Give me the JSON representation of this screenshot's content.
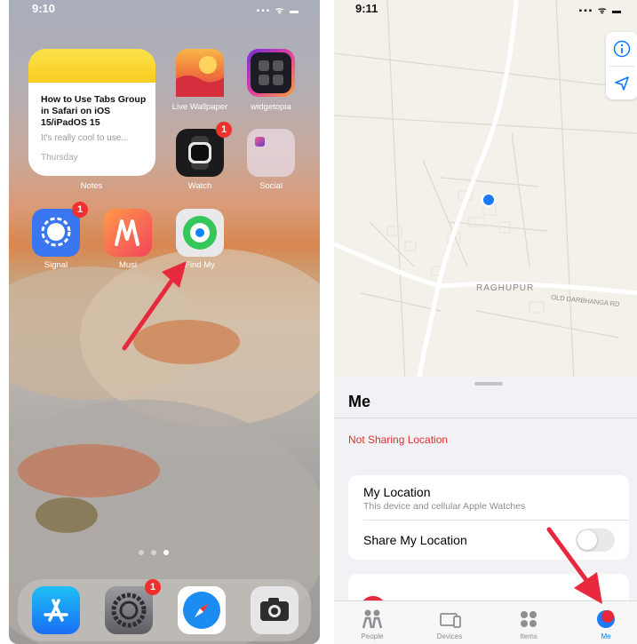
{
  "home": {
    "status_time": "9:10",
    "notes_widget": {
      "title": "How to Use Tabs Group in Safari on iOS 15/iPadOS 15",
      "preview": "It's really cool to use...",
      "day": "Thursday",
      "label": "Notes"
    },
    "apps": [
      {
        "label": "Live Wallpaper",
        "icon": "live-wallpaper-icon"
      },
      {
        "label": "widgetopia",
        "icon": "widgetopia-icon"
      },
      {
        "label": "Watch",
        "icon": "watch-icon",
        "badge": "1"
      },
      {
        "label": "Social",
        "icon": "folder-icon"
      },
      {
        "label": "Signal",
        "icon": "signal-icon",
        "badge": "1"
      },
      {
        "label": "Musi",
        "icon": "music-icon"
      },
      {
        "label": "Find My",
        "icon": "find-my-icon"
      }
    ],
    "dock": [
      {
        "icon": "app-store-icon"
      },
      {
        "icon": "settings-icon",
        "badge": "1"
      },
      {
        "icon": "safari-icon"
      },
      {
        "icon": "camera-icon"
      }
    ],
    "page_dots": 3,
    "active_page": 3
  },
  "findmy": {
    "status_time": "9:11",
    "map_labels": {
      "town": "RAGHUPUR",
      "road": "OLD DARBHANGA RD"
    },
    "sheet_title": "Me",
    "not_sharing": "Not Sharing Location",
    "my_location_title": "My Location",
    "my_location_sub": "This device and cellular Apple Watches",
    "share_label": "Share My Location",
    "share_enabled": false,
    "tabs": [
      {
        "label": "People",
        "icon": "people-icon"
      },
      {
        "label": "Devices",
        "icon": "devices-icon"
      },
      {
        "label": "Items",
        "icon": "items-icon"
      },
      {
        "label": "Me",
        "icon": "me-avatar-icon",
        "active": true
      }
    ],
    "colors": {
      "accent": "#0a7aff",
      "warning": "#e0302b",
      "arrow": "#e8283c"
    }
  }
}
